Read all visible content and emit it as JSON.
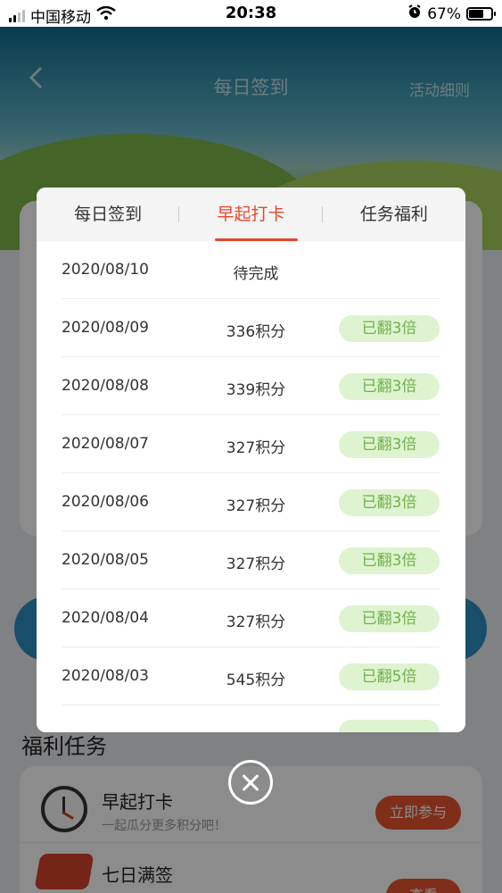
{
  "status_bar": {
    "carrier": "中国移动",
    "time": "20:38",
    "battery": "67%",
    "battery_level": 0.67
  },
  "header": {
    "title": "每日签到",
    "rules_link": "活动细则"
  },
  "welfare": {
    "section_title": "福利任务",
    "tasks": [
      {
        "name": "早起打卡",
        "desc": "一起瓜分更多积分吧！",
        "action": "立即参与"
      },
      {
        "name": "七日满签",
        "action": "查看"
      }
    ]
  },
  "modal": {
    "tabs": [
      {
        "label": "每日签到"
      },
      {
        "label": "早起打卡"
      },
      {
        "label": "任务福利"
      }
    ],
    "active_tab": "早起打卡",
    "records": [
      {
        "date": "2020/08/10",
        "points": "待完成",
        "badge": ""
      },
      {
        "date": "2020/08/09",
        "points": "336积分",
        "badge": "已翻3倍"
      },
      {
        "date": "2020/08/08",
        "points": "339积分",
        "badge": "已翻3倍"
      },
      {
        "date": "2020/08/07",
        "points": "327积分",
        "badge": "已翻3倍"
      },
      {
        "date": "2020/08/06",
        "points": "327积分",
        "badge": "已翻3倍"
      },
      {
        "date": "2020/08/05",
        "points": "327积分",
        "badge": "已翻3倍"
      },
      {
        "date": "2020/08/04",
        "points": "327积分",
        "badge": "已翻3倍"
      },
      {
        "date": "2020/08/03",
        "points": "545积分",
        "badge": "已翻5倍"
      }
    ]
  },
  "colors": {
    "accent": "#e8472d",
    "badge_bg": "#def3cf",
    "badge_text": "#6fb24a"
  },
  "icons": {
    "back": "chevron-left-icon",
    "close": "close-circle-icon",
    "alarm": "alarm-icon",
    "wifi": "wifi-icon"
  }
}
